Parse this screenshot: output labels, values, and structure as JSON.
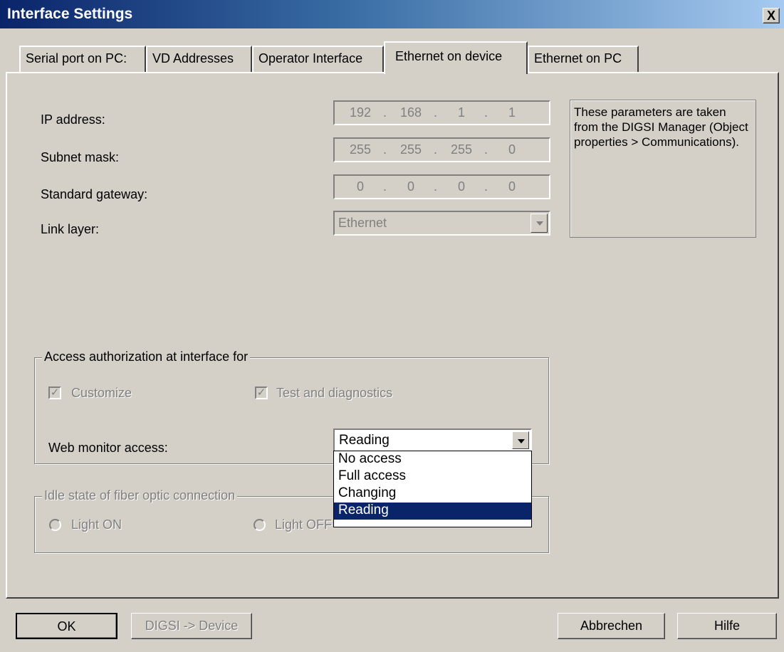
{
  "window": {
    "title": "Interface Settings",
    "close_label": "X"
  },
  "tabs": [
    {
      "label": "Serial port on PC:",
      "active": false
    },
    {
      "label": "VD Addresses",
      "active": false
    },
    {
      "label": "Operator Interface",
      "active": false
    },
    {
      "label": "Ethernet on device",
      "active": true
    },
    {
      "label": "Ethernet on PC",
      "active": false
    }
  ],
  "network": {
    "ip_label": "IP address:",
    "ip": [
      "192",
      "168",
      "1",
      "1"
    ],
    "subnet_label": "Subnet mask:",
    "subnet": [
      "255",
      "255",
      "255",
      "0"
    ],
    "gateway_label": "Standard gateway:",
    "gateway": [
      "0",
      "0",
      "0",
      "0"
    ],
    "link_label": "Link layer:",
    "link_value": "Ethernet",
    "info_text": "These parameters are taken from the DIGSI Manager (Object properties > Communications)."
  },
  "access": {
    "group_label": "Access authorization at interface for",
    "customize_label": "Customize",
    "customize_checked": true,
    "test_label": "Test and diagnostics",
    "test_checked": true,
    "web_label": "Web monitor access:",
    "web_value": "Reading",
    "web_options": [
      "No access",
      "Full access",
      "Changing",
      "Reading"
    ],
    "web_selected": "Reading"
  },
  "idle": {
    "group_label": "Idle state of fiber optic connection",
    "light_on_label": "Light ON",
    "light_off_label": "Light OFF"
  },
  "buttons": {
    "ok": "OK",
    "digsi": "DIGSI -> Device",
    "cancel": "Abbrechen",
    "help": "Hilfe"
  },
  "colors": {
    "face": "#d4d0c8",
    "title_start": "#0a246a",
    "title_end": "#a6caf0",
    "selection": "#0a246a",
    "disabled_text": "#808080"
  },
  "icons": {
    "close": "close-icon",
    "dropdown": "chevron-down-icon"
  }
}
